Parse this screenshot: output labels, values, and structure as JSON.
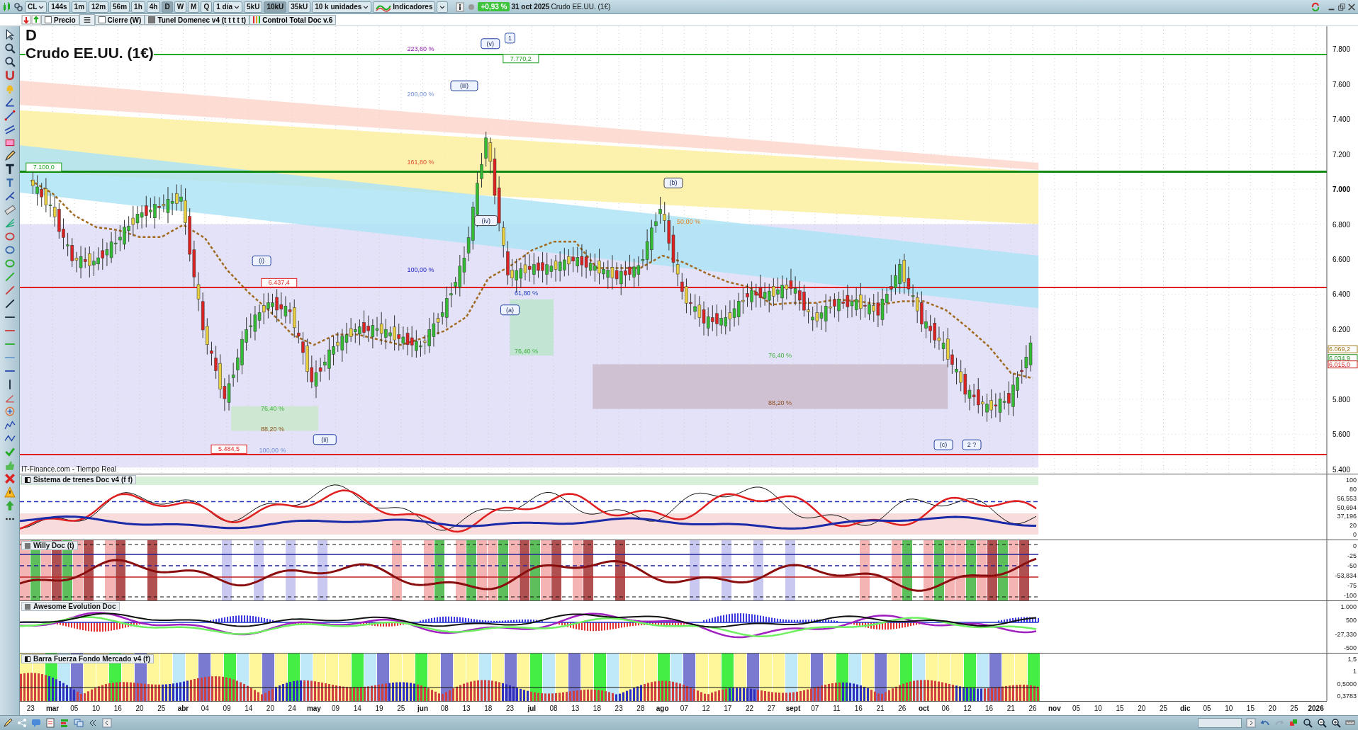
{
  "toolbar": {
    "symbol": "CL",
    "timeframes": [
      {
        "label": "144s",
        "selected": false
      },
      {
        "label": "1m",
        "selected": false
      },
      {
        "label": "12m",
        "selected": false
      },
      {
        "label": "56m",
        "selected": false
      },
      {
        "label": "1h",
        "selected": false
      },
      {
        "label": "4h",
        "selected": false
      },
      {
        "label": "D",
        "selected": true
      },
      {
        "label": "W",
        "selected": false
      },
      {
        "label": "M",
        "selected": false
      },
      {
        "label": "Q",
        "selected": false
      }
    ],
    "interval": "1 día",
    "units": [
      {
        "label": "5kU",
        "selected": false
      },
      {
        "label": "10kU",
        "selected": true
      },
      {
        "label": "35kU",
        "selected": false
      }
    ],
    "units_select": "10 k unidades",
    "indicators": "Indicadores",
    "change": "+0,93 %",
    "date": "31 oct 2025",
    "instrument": "Crudo EE.UU. (1€)"
  },
  "legend": [
    {
      "kind": "checkbox",
      "label": "Precio",
      "checked": false
    },
    {
      "kind": "list"
    },
    {
      "kind": "checkbox",
      "label": "Cierre (W)",
      "checked": false
    },
    {
      "kind": "checkbox",
      "label": "Tunel Domenec v4 (t t t t t)",
      "checked": true
    },
    {
      "kind": "indicator",
      "label": "Control Total Doc v.6"
    }
  ],
  "main": {
    "timeframe": "D",
    "title": "Crudo EE.UU. (1€)",
    "source": "IT-Finance.com - Tiempo Real",
    "axis_tags": [
      "6.069,2",
      "6.034,9",
      "6.015,0"
    ],
    "price_axis": [
      "7.800",
      "7.600",
      "7.400",
      "7.200",
      "7.000",
      "6.800",
      "6.600",
      "6.400",
      "6.200",
      "5.800",
      "5.600",
      "5.400"
    ],
    "date_axis": [
      "23",
      "mar",
      "05",
      "10",
      "16",
      "20",
      "25",
      "abr",
      "04",
      "09",
      "14",
      "20",
      "24",
      "may",
      "09",
      "14",
      "19",
      "25",
      "jun",
      "08",
      "13",
      "18",
      "23",
      "jul",
      "08",
      "13",
      "18",
      "23",
      "28",
      "ago",
      "07",
      "12",
      "17",
      "22",
      "27",
      "sept",
      "07",
      "11",
      "16",
      "21",
      "26",
      "oct",
      "06",
      "12",
      "16",
      "21",
      "26",
      "nov",
      "05",
      "10",
      "15",
      "20",
      "25",
      "dic",
      "05",
      "10",
      "15",
      "20",
      "25",
      "2026"
    ],
    "level_lines": [
      {
        "color": "#22aa22"
      },
      {
        "color": "#118811"
      },
      {
        "color": "#e02020"
      },
      {
        "color": "#e02020"
      }
    ],
    "chart_labels": [
      "223,60 %",
      "200,00 %",
      "161,80 %",
      "100,00 %",
      "61,80 %",
      "76,40 %",
      "76,40 %",
      "88,20 %",
      "100,00 %",
      "76,40 %",
      "88,20 %",
      "50,00 %",
      "(v)",
      "1",
      "(iii)",
      "(i)",
      "(ii)",
      "(iv)",
      "(a)",
      "(b)",
      "(c)",
      "2 ?",
      "7.770,2",
      "7.100,0",
      "6.437,4",
      "5.484,5"
    ]
  },
  "panes": [
    {
      "kind": "trains",
      "title": "Sistema de trenes Doc v4 (f f)",
      "axis_labels": [
        "100",
        "80",
        "56,553",
        "50,694",
        "37,196",
        "20",
        "0"
      ]
    },
    {
      "kind": "willy",
      "title": "Willy Doc (t)",
      "axis_labels": [
        "0",
        "-25",
        "-50",
        "-53,834",
        "-75",
        "-100"
      ]
    },
    {
      "kind": "awesome",
      "title": "Awesome Evolution Doc",
      "axis_labels": [
        "1.000",
        "500",
        "-27,330",
        "-500"
      ]
    },
    {
      "kind": "force",
      "title": "Barra Fuerza Fondo Mercado v4 (f)",
      "axis_labels": [
        "1,5",
        "1",
        "0,5000",
        "0,3783"
      ]
    }
  ]
}
